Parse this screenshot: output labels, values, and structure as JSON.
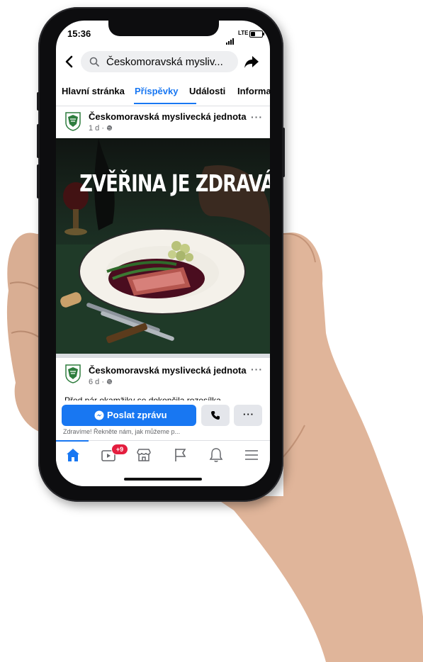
{
  "status_bar": {
    "time": "15:36",
    "network": "LTE"
  },
  "header": {
    "search_text": "Českomoravská mysliv..."
  },
  "tabs": [
    {
      "label": "Hlavní stránka",
      "active": false
    },
    {
      "label": "Příspěvky",
      "active": true
    },
    {
      "label": "Události",
      "active": false
    },
    {
      "label": "Informa",
      "active": false
    }
  ],
  "post1": {
    "page_name": "Českomoravská myslivecká jednota",
    "meta": "1 d · ",
    "image_headline": "ZVĚŘINA JE ZDRAVÁ!"
  },
  "post2": {
    "page_name": "Českomoravská myslivecká jednota",
    "meta": "6 d · ",
    "text": "Před pár okamžiky se dokončila rozesílka"
  },
  "actions": {
    "message_button": "Poslat zprávu",
    "hint": "Zdravíme! Řekněte nám, jak můžeme p..."
  },
  "bottom_nav": {
    "watch_badge": "+9"
  },
  "colors": {
    "accent": "#1877f2",
    "badge": "#e41e3f"
  },
  "icons": [
    "back-arrow-icon",
    "search-icon",
    "share-icon",
    "globe-icon",
    "more-icon",
    "messenger-icon",
    "phone-icon",
    "home-icon",
    "watch-icon",
    "marketplace-icon",
    "pages-icon",
    "bell-icon",
    "menu-icon"
  ]
}
